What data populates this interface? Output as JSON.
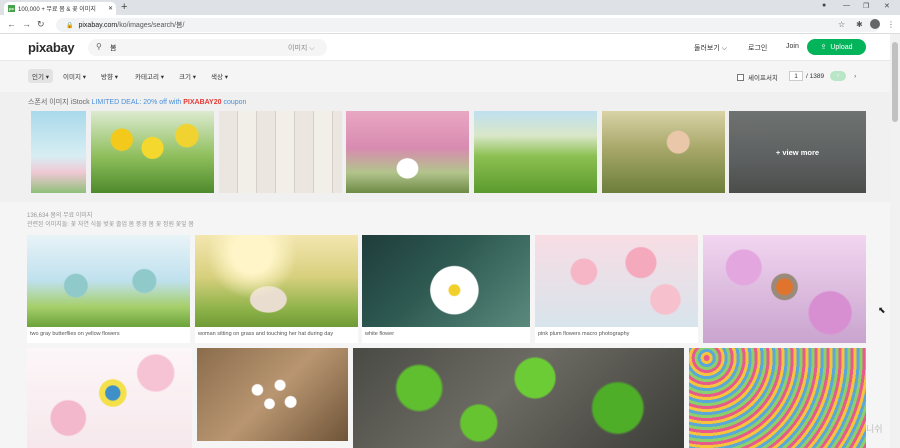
{
  "browser": {
    "tab_title": "100,000 + 무료 봄 & 꽃 이미지",
    "favicon_text": "px",
    "new_tab": "+",
    "url_domain": "pixabay.com",
    "url_path": "/ko/images/search/봄/",
    "window_minimize": "—",
    "window_restore": "❐",
    "window_close": "✕"
  },
  "header": {
    "logo": "pixabay",
    "search_value": "봄",
    "search_type": "이미지",
    "explore": "둘러보기",
    "login": "로그인",
    "join": "Join",
    "upload": "Upload"
  },
  "filters": {
    "items": [
      "인기",
      "이미지",
      "방향",
      "카테고리",
      "크기",
      "색상"
    ],
    "safesearch": "세이프서치",
    "page_current": "1",
    "page_total": "/ 1389"
  },
  "sponsored": {
    "label": "스폰서 이미지 iStock",
    "deal": "LIMITED DEAL: 20% off with",
    "code": "PIXABAY20",
    "coupon": "coupon",
    "view_more": "+ view more"
  },
  "results": {
    "count": "136,634 봄의 무료 이미지",
    "related": "관련된 이미지들:  꽃  자연  식물  벚꽃  졸업  봄 풍경  봄 꽃  정원  꽃잎  봄"
  },
  "cards": [
    {
      "caption": "two gray butterflies on yellow flowers"
    },
    {
      "caption": "woman sitting on grass and touching her hat during day"
    },
    {
      "caption": "white flower"
    },
    {
      "caption": "pink plum flowers macro photography"
    }
  ],
  "watermark": "니쉬"
}
